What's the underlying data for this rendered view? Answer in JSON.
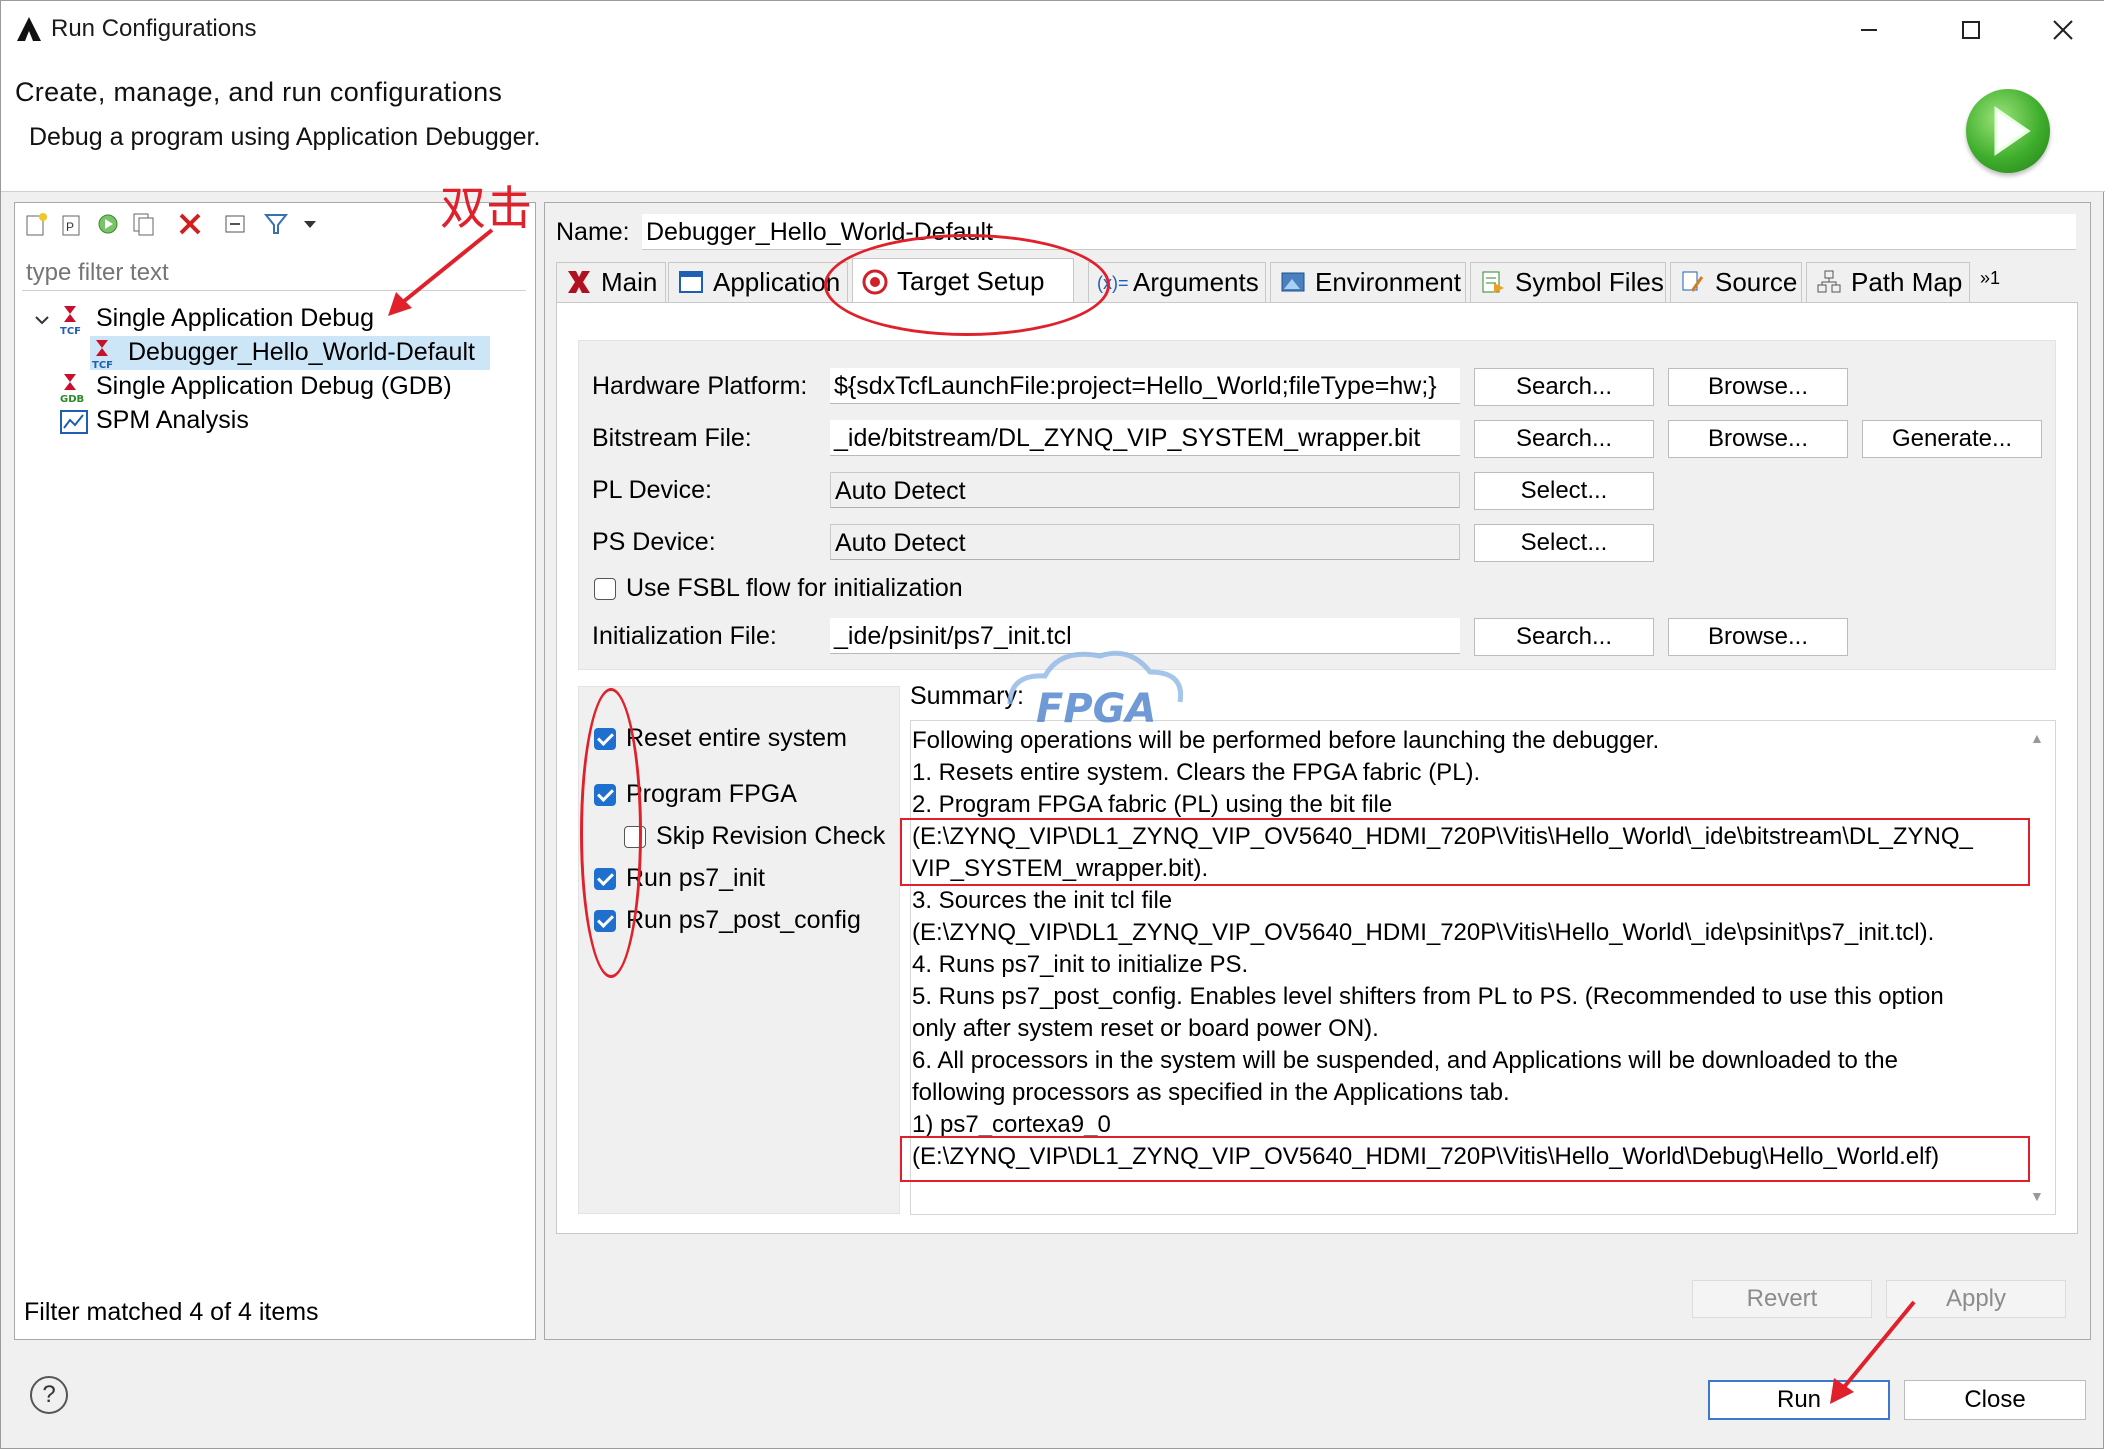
{
  "window": {
    "title": "Run Configurations",
    "minimize_icon": "minimize-icon",
    "maximize_icon": "maximize-icon",
    "close_icon": "close-icon"
  },
  "header": {
    "title": "Create, manage, and run configurations",
    "subtitle": "Debug a program using Application Debugger."
  },
  "left": {
    "filter_placeholder": "type filter text",
    "tree": [
      {
        "label": "Single Application Debug",
        "expanded": true
      },
      {
        "label": "Debugger_Hello_World-Default",
        "selected": true
      },
      {
        "label": "Single Application Debug (GDB)"
      },
      {
        "label": "SPM Analysis"
      }
    ],
    "status": "Filter matched 4 of 4 items"
  },
  "annotation": {
    "double_click_text": "双击"
  },
  "config": {
    "name_label": "Name:",
    "name_value": "Debugger_Hello_World-Default",
    "tabs": [
      "Main",
      "Application",
      "Target Setup",
      "Arguments",
      "Environment",
      "Symbol Files",
      "Source",
      "Path Map"
    ],
    "tabs_overflow": "»1",
    "active_tab": "Target Setup"
  },
  "target": {
    "hw_label": "Hardware Platform:",
    "hw_value": "${sdxTcfLaunchFile:project=Hello_World;fileType=hw;}",
    "bit_label": "Bitstream File:",
    "bit_value": "_ide/bitstream/DL_ZYNQ_VIP_SYSTEM_wrapper.bit",
    "pl_label": "PL Device:",
    "pl_value": "Auto Detect",
    "ps_label": "PS Device:",
    "ps_value": "Auto Detect",
    "fsbl_label": "Use FSBL flow for initialization",
    "init_label": "Initialization File:",
    "init_value": "_ide/psinit/ps7_init.tcl",
    "search": "Search...",
    "browse": "Browse...",
    "generate": "Generate...",
    "select": "Select..."
  },
  "options": {
    "reset": "Reset entire system",
    "program_fpga": "Program FPGA",
    "skip_rev": "Skip Revision Check",
    "run_init": "Run ps7_init",
    "run_post": "Run ps7_post_config",
    "checked": {
      "reset": true,
      "program_fpga": true,
      "skip_rev": false,
      "run_init": true,
      "run_post": true,
      "fsbl": false
    }
  },
  "summary": {
    "label": "Summary:",
    "lines": [
      "Following operations will be performed before launching the debugger.",
      "1. Resets entire system. Clears the FPGA fabric (PL).",
      "2. Program FPGA fabric (PL) using the bit file",
      "(E:\\ZYNQ_VIP\\DL1_ZYNQ_VIP_OV5640_HDMI_720P\\Vitis\\Hello_World\\_ide\\bitstream\\DL_ZYNQ_",
      "VIP_SYSTEM_wrapper.bit).",
      "3. Sources the init tcl file",
      "(E:\\ZYNQ_VIP\\DL1_ZYNQ_VIP_OV5640_HDMI_720P\\Vitis\\Hello_World\\_ide\\psinit\\ps7_init.tcl).",
      "4. Runs ps7_init to initialize PS.",
      "5. Runs ps7_post_config. Enables level shifters from PL to PS. (Recommended to use this option",
      "only after system reset or board power ON).",
      "6. All processors in the system will be suspended, and Applications will be downloaded to the",
      "following processors as specified in the Applications tab.",
      "    1) ps7_cortexa9_0",
      "(E:\\ZYNQ_VIP\\DL1_ZYNQ_VIP_OV5640_HDMI_720P\\Vitis\\Hello_World\\Debug\\Hello_World.elf)"
    ]
  },
  "watermark": "FPGA",
  "footer": {
    "revert": "Revert",
    "apply": "Apply",
    "run": "Run",
    "close": "Close",
    "help": "?"
  }
}
